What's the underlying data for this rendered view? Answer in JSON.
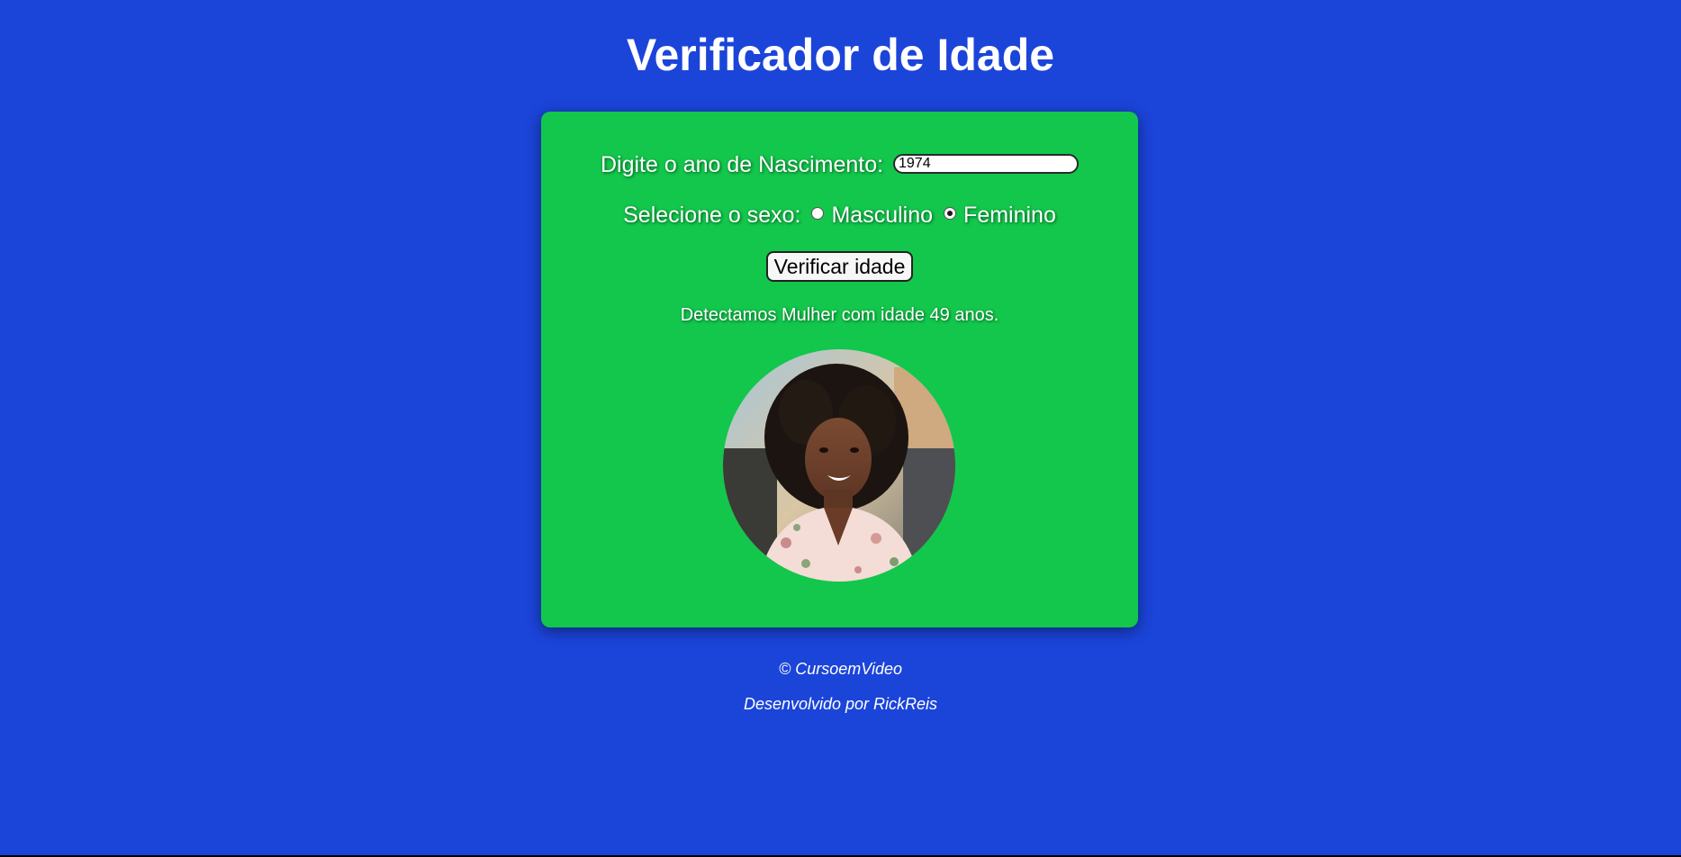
{
  "page": {
    "title": "Verificador de Idade"
  },
  "form": {
    "year_label": "Digite o ano de Nascimento:",
    "year_value": "1974",
    "sex_label": "Selecione o sexo:",
    "options": [
      {
        "label": "Masculino",
        "selected": false
      },
      {
        "label": "Feminino",
        "selected": true
      }
    ],
    "button_label": "Verificar idade"
  },
  "result": {
    "text": "Detectamos Mulher com idade 49 anos."
  },
  "footer": {
    "copyright": "© CursoemVideo",
    "developer": "Desenvolvido por RickReis"
  },
  "colors": {
    "background": "#1b44d9",
    "panel": "#12c74b",
    "text": "#ffffff"
  }
}
